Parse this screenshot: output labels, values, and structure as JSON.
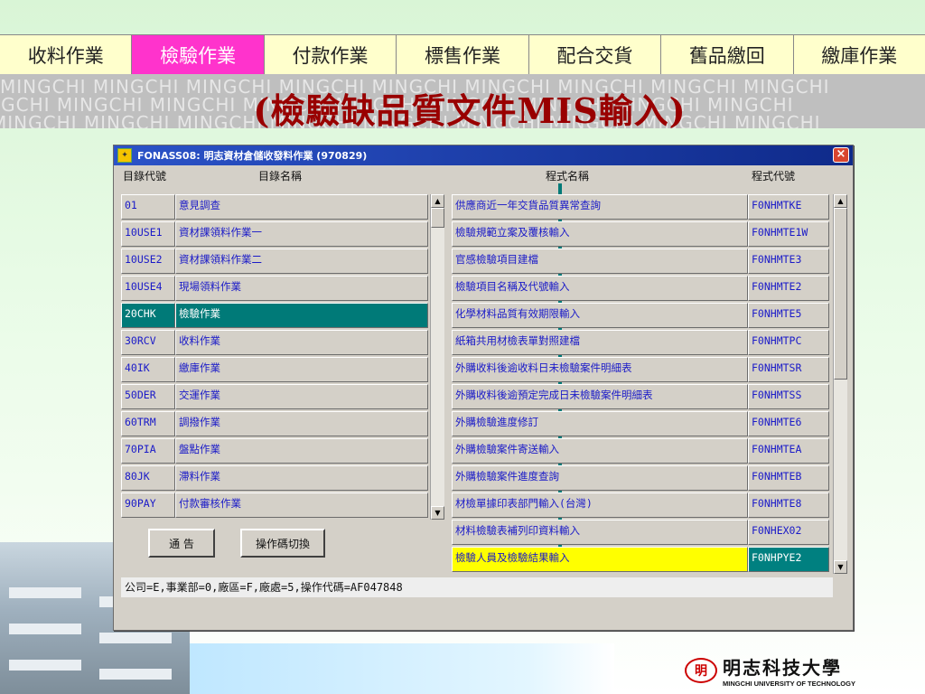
{
  "nav_tabs": [
    {
      "label": "收料作業"
    },
    {
      "label": "檢驗作業"
    },
    {
      "label": "付款作業"
    },
    {
      "label": "標售作業"
    },
    {
      "label": "配合交貨"
    },
    {
      "label": "舊品繳回"
    },
    {
      "label": "繳庫作業"
    }
  ],
  "active_tab": 1,
  "watermark_text": "MINGCHI MINGCHI MINGCHI MINGCHI MINGCHI MINGCHI MINGCHI MINGCHI MINGCHI",
  "headline": "(檢驗缺品質文件MIS輸入)",
  "window": {
    "title": "FONASS08: 明志資材倉儲收發料作業 (970829)",
    "close_label": "×",
    "col_dir_code": "目錄代號",
    "col_dir_name": "目錄名稱",
    "col_prog_name": "程式名稱",
    "col_prog_code": "程式代號",
    "directories": [
      {
        "code": "01",
        "name": "意見調查"
      },
      {
        "code": "10USE1",
        "name": "資材課領料作業一"
      },
      {
        "code": "10USE2",
        "name": "資材課領料作業二"
      },
      {
        "code": "10USE4",
        "name": "現場領料作業"
      },
      {
        "code": "20CHK",
        "name": "檢驗作業"
      },
      {
        "code": "30RCV",
        "name": "收料作業"
      },
      {
        "code": "40IK",
        "name": "繳庫作業"
      },
      {
        "code": "50DER",
        "name": "交運作業"
      },
      {
        "code": "60TRM",
        "name": "調撥作業"
      },
      {
        "code": "70PIA",
        "name": "盤點作業"
      },
      {
        "code": "80JK",
        "name": "滯料作業"
      },
      {
        "code": "90PAY",
        "name": "付款審核作業"
      }
    ],
    "selected_directory": 4,
    "programs": [
      {
        "name": "供應商近一年交貨品質異常查詢",
        "code": "F0NHMTKE"
      },
      {
        "name": "檢驗規範立案及覆核輸入",
        "code": "F0NHMTE1W"
      },
      {
        "name": "官感檢驗項目建檔",
        "code": "F0NHMTE3"
      },
      {
        "name": "檢驗項目名稱及代號輸入",
        "code": "F0NHMTE2"
      },
      {
        "name": "化學材料品質有效期限輸入",
        "code": "F0NHMTE5"
      },
      {
        "name": "紙箱共用材檢表單對照建檔",
        "code": "F0NHMTPC"
      },
      {
        "name": "外購收料後逾收料日未檢驗案件明細表",
        "code": "F0NHMTSR"
      },
      {
        "name": "外購收料後逾預定完成日未檢驗案件明細表",
        "code": "F0NHMTSS"
      },
      {
        "name": "外購檢驗進度修訂",
        "code": "F0NHMTE6"
      },
      {
        "name": "外購檢驗案件寄送輸入",
        "code": "F0NHMTEA"
      },
      {
        "name": "外購檢驗案件進度查詢",
        "code": "F0NHMTEB"
      },
      {
        "name": "材檢單據印表部門輸入(台灣)",
        "code": "F0NHMTE8"
      },
      {
        "name": "材料檢驗表補列印資料輸入",
        "code": "F0NHEX02"
      },
      {
        "name": "檢驗人員及檢驗結果輸入",
        "code": "F0NHPYE2"
      }
    ],
    "highlighted_program": 13,
    "button_notice": "通 告",
    "button_switch": "操作碼切換",
    "status_text": "公司=E,事業部=0,廠區=F,廠處=5,操作代碼=AF047848"
  },
  "logo": {
    "mark": "明",
    "name_zh": "明志科技大學",
    "name_en": "MINGCHI UNIVERSITY OF TECHNOLOGY"
  },
  "colors": {
    "active_tab": "#ff33cc",
    "tab_bg": "#ffffcc",
    "headline": "#990000",
    "selection": "#007a78",
    "highlight": "#ffff00",
    "list_text": "#1a1ac8"
  },
  "icons": {
    "app": "application-icon",
    "close": "close-icon",
    "scroll_up": "arrow-up-icon",
    "scroll_down": "arrow-down-icon"
  }
}
